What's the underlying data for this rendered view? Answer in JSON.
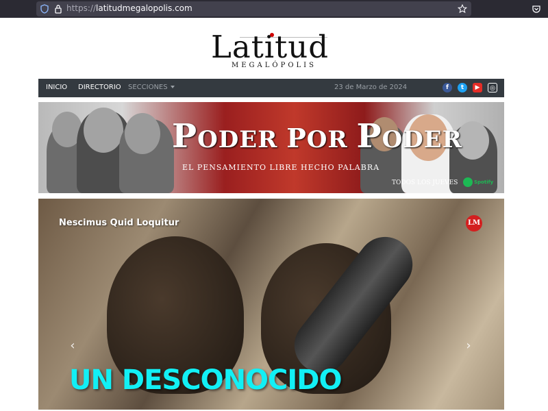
{
  "browser": {
    "url_scheme": "https://",
    "url_host": "latitudmegalopolis.com"
  },
  "logo": {
    "word": "Latitud",
    "sub": "MEGALÓPOLIS"
  },
  "nav": {
    "items": [
      "INICIO",
      "DIRECTORIO"
    ],
    "sections_label": "SECCIONES",
    "date": "23 de Marzo de 2024",
    "social": [
      "facebook-icon",
      "twitter-icon",
      "youtube-icon",
      "instagram-icon"
    ]
  },
  "banner": {
    "title_p1": "P",
    "title_w1": "ODER",
    "title_p2": "P",
    "title_w2": "OR",
    "title_p3": "P",
    "title_w3": "ODER",
    "tagline": "EL PENSAMIENTO LIBRE HECHO PALABRA",
    "schedule": "TODOS LOS JUEVES",
    "platform": "Spotify"
  },
  "hero": {
    "kicker": "Nescimus Quid Loquitur",
    "badge": "LM",
    "headline": "UN DESCONOCIDO",
    "prev": "‹",
    "next": "›"
  },
  "colors": {
    "navbar": "#343a40",
    "headline": "#12f0f5",
    "badge": "#d31f1f"
  }
}
